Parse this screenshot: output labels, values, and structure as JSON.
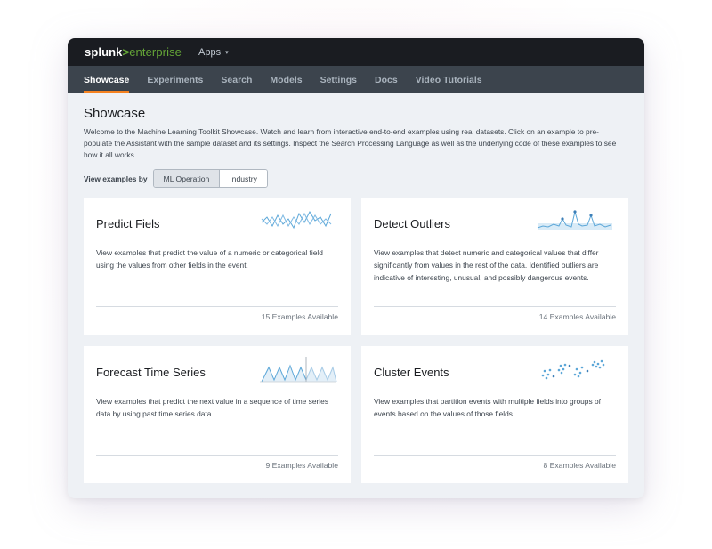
{
  "header": {
    "logo_splunk": "splunk",
    "logo_gt": ">",
    "logo_enterprise": "enterprise",
    "apps_label": "Apps",
    "apps_caret": "▾"
  },
  "nav": {
    "items": [
      "Showcase",
      "Experiments",
      "Search",
      "Models",
      "Settings",
      "Docs",
      "Video Tutorials"
    ],
    "active": "Showcase"
  },
  "main": {
    "title": "Showcase",
    "intro": "Welcome to the Machine Learning Toolkit Showcase. Watch and learn from interactive end-to-end examples using real datasets. Click on an example to pre-populate the Assistant with the sample dataset and its settings. Inspect the Search Processing Language as well as the underlying code of these examples to see how it all works.",
    "filter_label": "View examples by",
    "filter_options": [
      "ML Operation",
      "Industry"
    ],
    "filter_selected": "ML Operation"
  },
  "cards": [
    {
      "title": "Predict Fiels",
      "description": "View examples that predict the value of a numeric or categorical field using the values from other fields in the event.",
      "count": "15 Examples Available",
      "icon": "line-chart-icon"
    },
    {
      "title": "Detect Outliers",
      "description": "View examples that detect numeric and categorical values that differ significantly from values in the rest of the data. Identified outliers are indicative of interesting, unusual, and possibly dangerous events.",
      "count": "14 Examples Available",
      "icon": "outlier-chart-icon"
    },
    {
      "title": "Forecast Time Series",
      "description": "View examples that predict the next value in a sequence of time series data by using past time series data.",
      "count": "9 Examples Available",
      "icon": "forecast-chart-icon"
    },
    {
      "title": "Cluster Events",
      "description": "View examples that partition events with multiple fields into groups of events based on the values of those fields.",
      "count": "8 Examples Available",
      "icon": "scatter-cluster-icon"
    }
  ],
  "colors": {
    "accent_orange": "#f58220",
    "brand_green": "#65a637",
    "chart_blue": "#5ca7d8",
    "topbar": "#1a1c21",
    "navbar": "#3c444d"
  }
}
